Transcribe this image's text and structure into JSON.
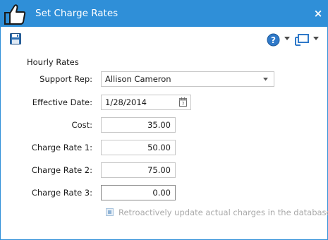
{
  "window": {
    "title": "Set Charge Rates",
    "close_label": "×",
    "accent_color": "#2f8fd8",
    "title_icon": "thumbs-up-icon"
  },
  "toolbar": {
    "save_icon": "save-icon",
    "help_icon": "help-icon",
    "view_icon": "view-options-icon"
  },
  "form": {
    "section_title": "Hourly Rates",
    "support_rep": {
      "label": "Support Rep:",
      "value": "Allison Cameron"
    },
    "effective_date": {
      "label": "Effective Date:",
      "value": "1/28/2014"
    },
    "cost": {
      "label": "Cost:",
      "value": "35.00"
    },
    "charge_rate_1": {
      "label": "Charge Rate 1:",
      "value": "50.00"
    },
    "charge_rate_2": {
      "label": "Charge Rate 2:",
      "value": "75.00"
    },
    "charge_rate_3": {
      "label": "Charge Rate 3:",
      "value": "0.00"
    },
    "retroactive": {
      "label": "Retroactively update actual charges in the database",
      "checked": true,
      "enabled": false
    }
  }
}
